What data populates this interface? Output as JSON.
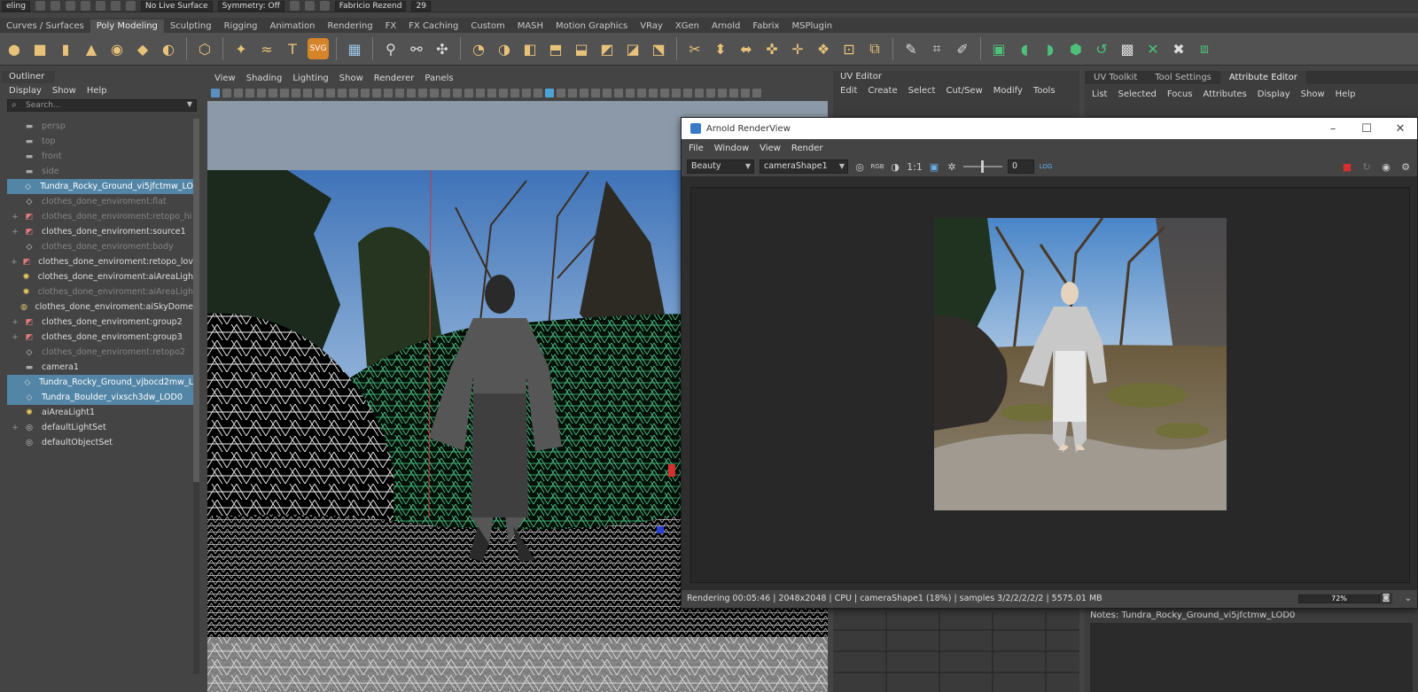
{
  "status_line": {
    "mode": "eling",
    "live_surface": "No Live Surface",
    "symmetry": "Symmetry: Off",
    "user": "Fabricio Rezend",
    "count": "29"
  },
  "shelf_tabs": [
    "Curves / Surfaces",
    "Poly Modeling",
    "Sculpting",
    "Rigging",
    "Animation",
    "Rendering",
    "FX",
    "FX Caching",
    "Custom",
    "MASH",
    "Motion Graphics",
    "VRay",
    "XGen",
    "Arnold",
    "Fabrix",
    "MSPlugin"
  ],
  "shelf_active": "Poly Modeling",
  "outliner": {
    "title": "Outliner",
    "menu": [
      "Display",
      "Show",
      "Help"
    ],
    "search_placeholder": "Search...",
    "items": [
      {
        "label": "persp",
        "state": "dim",
        "icon": "camera-icon",
        "expand": ""
      },
      {
        "label": "top",
        "state": "dim",
        "icon": "camera-icon",
        "expand": ""
      },
      {
        "label": "front",
        "state": "dim",
        "icon": "camera-icon",
        "expand": ""
      },
      {
        "label": "side",
        "state": "dim",
        "icon": "camera-icon",
        "expand": ""
      },
      {
        "label": "Tundra_Rocky_Ground_vi5jfctmw_LO",
        "state": "sel",
        "icon": "mesh-icon",
        "expand": ""
      },
      {
        "label": "clothes_done_enviroment:flat",
        "state": "dim",
        "icon": "mesh-icon",
        "expand": ""
      },
      {
        "label": "clothes_done_enviroment:retopo_hi",
        "state": "dim",
        "icon": "group-icon",
        "expand": "+"
      },
      {
        "label": "clothes_done_enviroment:source1",
        "state": "normal",
        "icon": "group-icon",
        "expand": "+"
      },
      {
        "label": "clothes_done_enviroment:body",
        "state": "dim",
        "icon": "mesh-icon",
        "expand": ""
      },
      {
        "label": "clothes_done_enviroment:retopo_lov",
        "state": "normal",
        "icon": "group-icon",
        "expand": "+"
      },
      {
        "label": "clothes_done_enviroment:aiAreaLigh",
        "state": "normal",
        "icon": "light-icon",
        "expand": ""
      },
      {
        "label": "clothes_done_enviroment:aiAreaLigh",
        "state": "dim",
        "icon": "light-icon",
        "expand": ""
      },
      {
        "label": "clothes_done_enviroment:aiSkyDome",
        "state": "normal",
        "icon": "skydome-icon",
        "expand": ""
      },
      {
        "label": "clothes_done_enviroment:group2",
        "state": "normal",
        "icon": "group-icon",
        "expand": "+"
      },
      {
        "label": "clothes_done_enviroment:group3",
        "state": "normal",
        "icon": "group-icon",
        "expand": "+"
      },
      {
        "label": "clothes_done_enviroment:retopo2",
        "state": "dim",
        "icon": "mesh-icon",
        "expand": ""
      },
      {
        "label": "camera1",
        "state": "normal",
        "icon": "camera-icon",
        "expand": ""
      },
      {
        "label": "Tundra_Rocky_Ground_vjbocd2mw_L",
        "state": "sel",
        "icon": "mesh-icon",
        "expand": ""
      },
      {
        "label": "Tundra_Boulder_vixsch3dw_LOD0",
        "state": "sel",
        "icon": "mesh-icon",
        "expand": ""
      },
      {
        "label": "aiAreaLight1",
        "state": "normal",
        "icon": "light-icon",
        "expand": ""
      },
      {
        "label": "defaultLightSet",
        "state": "normal",
        "icon": "set-icon",
        "expand": "+"
      },
      {
        "label": "defaultObjectSet",
        "state": "normal",
        "icon": "set-icon",
        "expand": ""
      }
    ]
  },
  "viewport": {
    "menu": [
      "View",
      "Shading",
      "Lighting",
      "Show",
      "Renderer",
      "Panels"
    ]
  },
  "uv_editor": {
    "title": "UV Editor",
    "menu": [
      "Edit",
      "Create",
      "Select",
      "Cut/Sew",
      "Modify",
      "Tools"
    ]
  },
  "attr_editor": {
    "tabs": [
      "UV Toolkit",
      "Tool Settings",
      "Attribute Editor"
    ],
    "active_tab": "Attribute Editor",
    "menu": [
      "List",
      "Selected",
      "Focus",
      "Attributes",
      "Display",
      "Show",
      "Help"
    ],
    "notes_label": "Notes: Tundra_Rocky_Ground_vi5jfctmw_LOD0"
  },
  "render_view": {
    "title": "Arnold RenderView",
    "menu": [
      "File",
      "Window",
      "View",
      "Render"
    ],
    "aov": "Beauty",
    "camera": "cameraShape1",
    "ratio": "1:1",
    "exposure": "0",
    "status": "Rendering 00:05:46 | 2048x2048 | CPU | cameraShape1 (18%) | samples 3/2/2/2/2/2 | 5575.01 MB",
    "progress_pct": 72,
    "progress_label": "72%"
  },
  "colors": {
    "selection": "#5285a6",
    "wire_green": "#5ff0a8",
    "panel": "#444444"
  }
}
